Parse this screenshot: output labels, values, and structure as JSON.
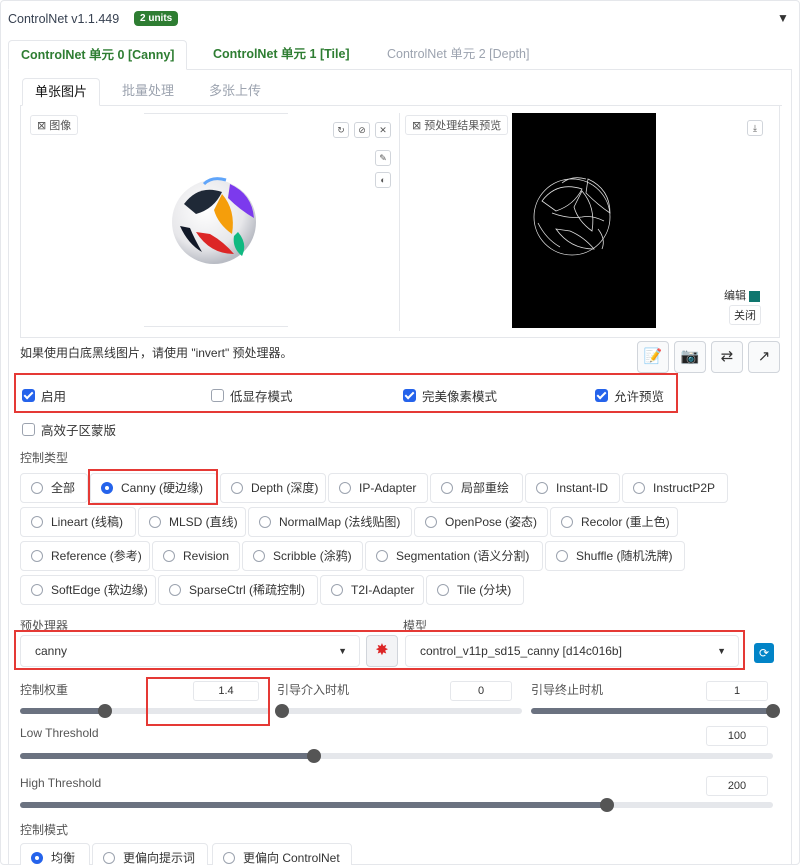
{
  "header": {
    "title": "ControlNet v1.1.449",
    "badge": "2 units"
  },
  "unit_tabs": [
    "ControlNet 单元 0 [Canny]",
    "ControlNet 单元 1 [Tile]",
    "ControlNet 单元 2 [Depth]"
  ],
  "image_tabs": [
    "单张图片",
    "批量处理",
    "多张上传"
  ],
  "image_panel": {
    "label": "图像"
  },
  "preview_panel": {
    "label": "预处理结果预览",
    "edit": "编辑",
    "close": "关闭"
  },
  "hint": "如果使用白底黑线图片，请使用 \"invert\" 预处理器。",
  "checkboxes": [
    {
      "label": "启用",
      "checked": true
    },
    {
      "label": "低显存模式",
      "checked": false
    },
    {
      "label": "完美像素模式",
      "checked": true
    },
    {
      "label": "允许预览",
      "checked": true
    },
    {
      "label": "高效子区蒙版",
      "checked": false
    }
  ],
  "control_type": {
    "label": "控制类型",
    "options": [
      "全部",
      "Canny (硬边缘)",
      "Depth (深度)",
      "IP-Adapter",
      "局部重绘",
      "Instant-ID",
      "InstructP2P",
      "Lineart (线稿)",
      "MLSD (直线)",
      "NormalMap (法线贴图)",
      "OpenPose (姿态)",
      "Recolor (重上色)",
      "Reference (参考)",
      "Revision",
      "Scribble (涂鸦)",
      "Segmentation (语义分割)",
      "Shuffle (随机洗牌)",
      "SoftEdge (软边缘)",
      "SparseCtrl (稀疏控制)",
      "T2I-Adapter",
      "Tile (分块)"
    ],
    "selected": "Canny (硬边缘)"
  },
  "preprocessor": {
    "label": "预处理器",
    "value": "canny"
  },
  "model": {
    "label": "模型",
    "value": "control_v11p_sd15_canny [d14c016b]"
  },
  "sliders": {
    "weight": {
      "label": "控制权重",
      "value": "1.4",
      "fraction": 0.34
    },
    "start": {
      "label": "引导介入时机",
      "value": "0",
      "fraction": 0.0
    },
    "end": {
      "label": "引导终止时机",
      "value": "1",
      "fraction": 1.0
    },
    "low": {
      "label": "Low Threshold",
      "value": "100",
      "fraction": 0.39
    },
    "high": {
      "label": "High Threshold",
      "value": "200",
      "fraction": 0.78
    }
  },
  "control_mode": {
    "label": "控制模式",
    "options": [
      "均衡",
      "更偏向提示词",
      "更偏向 ControlNet"
    ],
    "selected": "均衡"
  }
}
